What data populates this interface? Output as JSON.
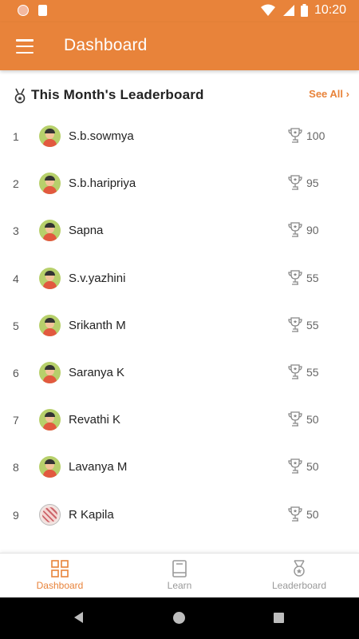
{
  "status_bar": {
    "time": "10:20",
    "icons": [
      "notification-dot-icon",
      "sd-card-icon",
      "wifi-icon",
      "signal-icon",
      "battery-icon"
    ]
  },
  "app_bar": {
    "title": "Dashboard",
    "menu_icon": "hamburger-menu-icon"
  },
  "leaderboard": {
    "title": "This Month's Leaderboard",
    "see_all": "See All",
    "entries": [
      {
        "rank": "1",
        "name": "S.b.sowmya",
        "score": "100",
        "avatar": "default"
      },
      {
        "rank": "2",
        "name": "S.b.haripriya",
        "score": "95",
        "avatar": "default"
      },
      {
        "rank": "3",
        "name": "Sapna",
        "score": "90",
        "avatar": "default"
      },
      {
        "rank": "4",
        "name": "S.v.yazhini",
        "score": "55",
        "avatar": "default"
      },
      {
        "rank": "5",
        "name": "Srikanth M",
        "score": "55",
        "avatar": "default"
      },
      {
        "rank": "6",
        "name": "Saranya K",
        "score": "55",
        "avatar": "default"
      },
      {
        "rank": "7",
        "name": "Revathi K",
        "score": "50",
        "avatar": "default"
      },
      {
        "rank": "8",
        "name": "Lavanya M",
        "score": "50",
        "avatar": "default"
      },
      {
        "rank": "9",
        "name": "R Kapila",
        "score": "50",
        "avatar": "photo"
      }
    ]
  },
  "bottom_nav": {
    "items": [
      {
        "label": "Dashboard",
        "icon": "dashboard-grid-icon",
        "active": true
      },
      {
        "label": "Learn",
        "icon": "book-icon",
        "active": false
      },
      {
        "label": "Leaderboard",
        "icon": "medal-icon",
        "active": false
      }
    ]
  },
  "colors": {
    "accent": "#e8833a",
    "avatar_bg": "#b7d06b",
    "inactive": "#999999"
  }
}
